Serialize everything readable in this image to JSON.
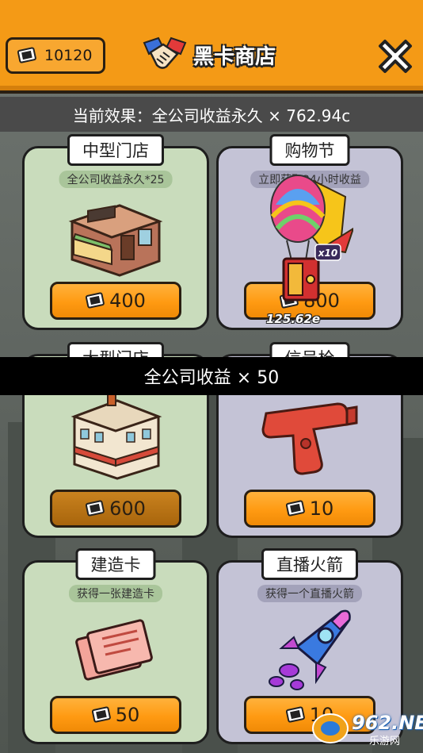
{
  "header": {
    "currency_amount": "10120",
    "currency_icon": "black-card-icon",
    "title": "黑卡商店",
    "title_icon": "handshake-icon",
    "close_icon": "close-icon",
    "accent_color": "#f49a16"
  },
  "effect_bar": {
    "text": "当前效果：全公司收益永久 × 762.94c"
  },
  "cards": [
    {
      "name": "中型门店",
      "desc": "全公司收益永久*25",
      "price": "400",
      "theme": "green"
    },
    {
      "name": "购物节",
      "desc": "立即获取24小时收益",
      "price": "800",
      "theme": "purple"
    },
    {
      "name": "大型门店",
      "desc": "",
      "price": "600",
      "theme": "green"
    },
    {
      "name": "信号枪",
      "desc": "",
      "price": "10",
      "theme": "purple"
    },
    {
      "name": "建造卡",
      "desc": "获得一张建造卡",
      "price": "50",
      "theme": "green"
    },
    {
      "name": "直播火箭",
      "desc": "获得一个直播火箭",
      "price": "10",
      "theme": "purple"
    }
  ],
  "reward_popup": {
    "multiplier": "x10",
    "value": "125.62e"
  },
  "toast": {
    "text": "全公司收益 × 50"
  },
  "watermark": {
    "text": "962.NET",
    "sub": "乐游网"
  }
}
